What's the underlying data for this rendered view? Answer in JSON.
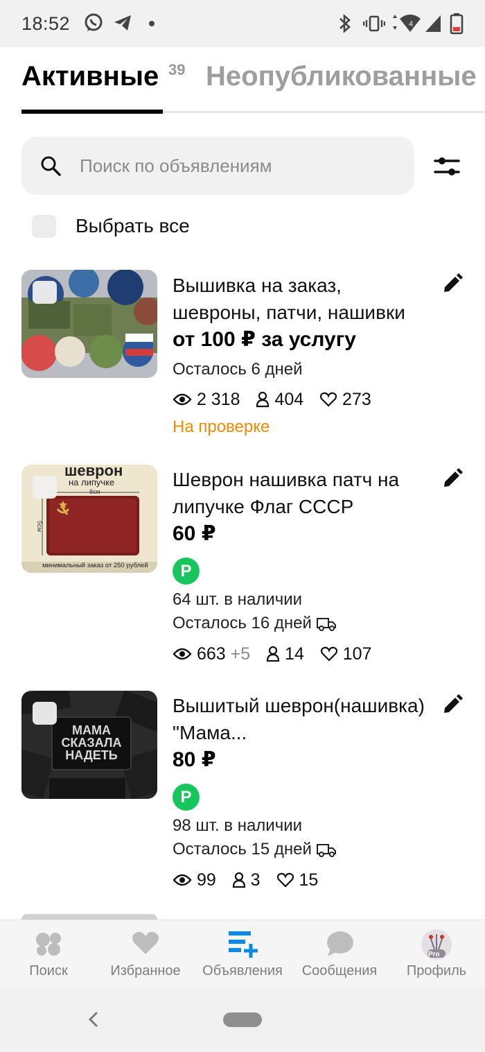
{
  "status_bar": {
    "time": "18:52",
    "icons": [
      "whatsapp-icon",
      "telegram-icon",
      "notification-dot-icon",
      "bluetooth-icon",
      "vibrate-icon",
      "wifi-icon",
      "signal-icon",
      "battery-low-icon"
    ],
    "network_label": "4"
  },
  "tabs": {
    "active_label": "Активные",
    "active_count": "39",
    "inactive_label": "Неопубликованные"
  },
  "search": {
    "placeholder": "Поиск по объявлениям"
  },
  "select_all": {
    "label": "Выбрать все"
  },
  "listings": [
    {
      "title": "Вышивка на заказ, шевроны, патчи, нашивки",
      "price": "от 100 ₽ за услугу",
      "remaining": "Осталось 6 дней",
      "views": "2 318",
      "contacts": "404",
      "favorites": "273",
      "status": "На проверке"
    },
    {
      "title": "Шеврон нашивка патч на липучке Флаг СССР",
      "price": "60 ₽",
      "badge": "P",
      "stock": "64 шт. в наличии",
      "remaining": "Осталось 16 дней",
      "views": "663",
      "views_plus": "+5",
      "contacts": "14",
      "favorites": "107",
      "thumb_text": {
        "top": "шеврон",
        "sub": "на липучке",
        "width": "8см",
        "height": "5см",
        "bottom": "минимальный заказ от 250 рублей"
      }
    },
    {
      "title": "Вышитый шеврон(нашивка) \"Мама...",
      "price": "80 ₽",
      "badge": "P",
      "stock": "98 шт. в наличии",
      "remaining": "Осталось 15 дней",
      "views": "99",
      "contacts": "3",
      "favorites": "15",
      "thumb_text": {
        "line1": "МАМА",
        "line2": "СКАЗАЛА",
        "line3": "НАДЕТЬ"
      }
    }
  ],
  "bottom_nav": [
    {
      "label": "Поиск",
      "icon": "search-blobs-icon",
      "active": false
    },
    {
      "label": "Избранное",
      "icon": "heart-icon",
      "active": false
    },
    {
      "label": "Объявления",
      "icon": "listings-add-icon",
      "active": true
    },
    {
      "label": "Сообщения",
      "icon": "chat-bubble-icon",
      "active": false
    },
    {
      "label": "Профиль",
      "icon": "avatar",
      "active": false,
      "avatar_badge": "Pro"
    }
  ],
  "colors": {
    "accent_blue": "#0a8ae6",
    "status_orange": "#f28b00",
    "badge_green": "#16c55c"
  }
}
